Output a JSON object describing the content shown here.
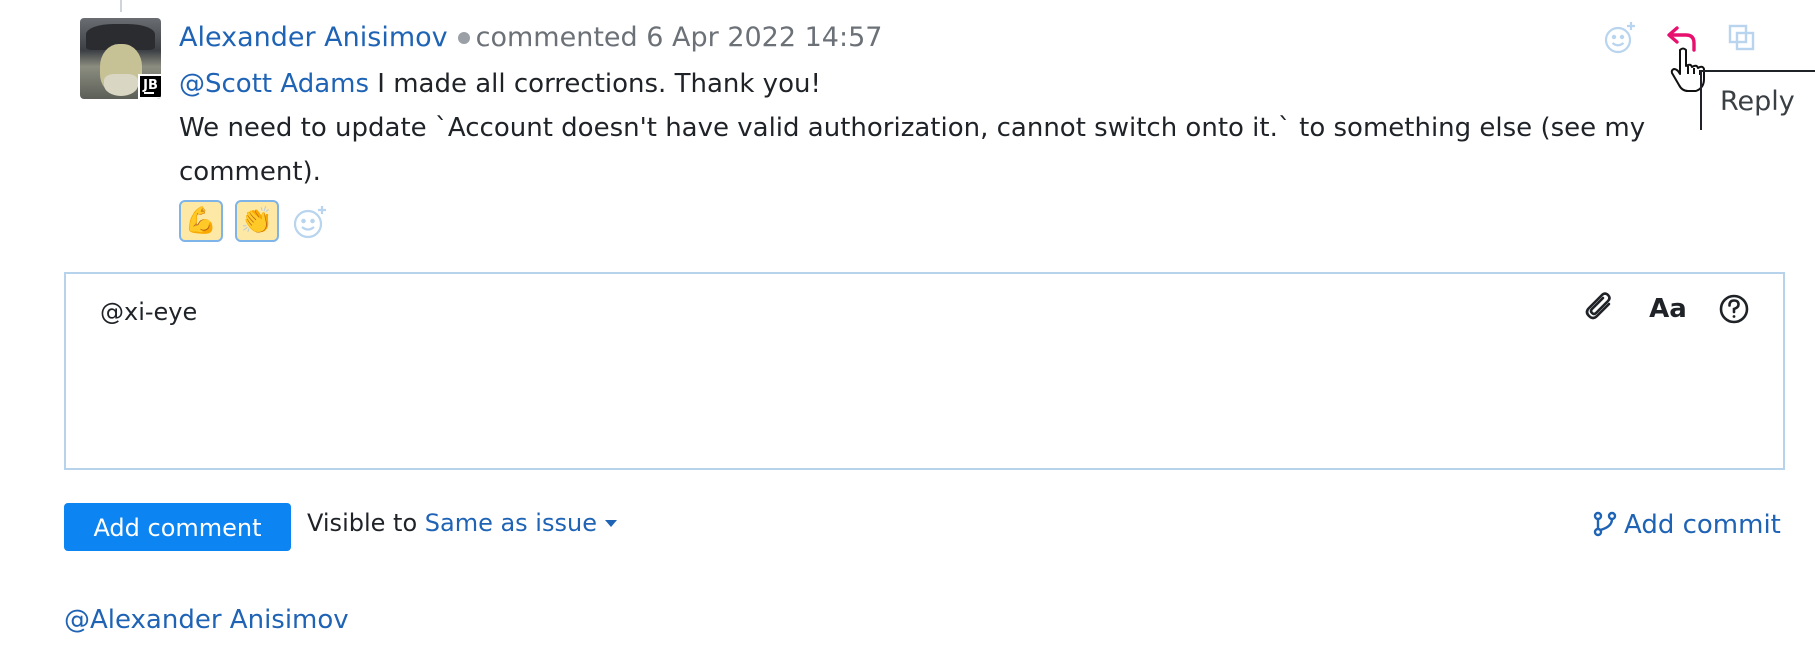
{
  "comment": {
    "author": "Alexander Anisimov",
    "action": "commented",
    "timestamp": "6 Apr 2022 14:57",
    "avatar_badge": "JB",
    "mention": "@Scott Adams",
    "line1": " I made all corrections. Thank you!",
    "line2": "We need to update `Account doesn't have valid authorization, cannot switch onto it.` to something else (see my comment).",
    "reactions": [
      "💪",
      "👏"
    ]
  },
  "actions": {
    "tooltip": "Reply",
    "icons": [
      "add-reaction-icon",
      "reply-icon",
      "copy-link-icon"
    ],
    "reply_color": "#e8106f"
  },
  "editor": {
    "value": "@xi-eye",
    "tools": [
      "attachment-icon",
      "text-format-icon",
      "help-icon"
    ],
    "format_label": "Aa"
  },
  "footer": {
    "add_comment_label": "Add comment",
    "visible_to_label": "Visible to ",
    "visibility_value": "Same as issue",
    "add_commit_label": "Add commit"
  },
  "bottom": {
    "mention": "@Alexander Anisimov"
  },
  "colors": {
    "link": "#1f63b5",
    "primary_button": "#0c84f2",
    "editor_border": "#b7d3ec"
  }
}
